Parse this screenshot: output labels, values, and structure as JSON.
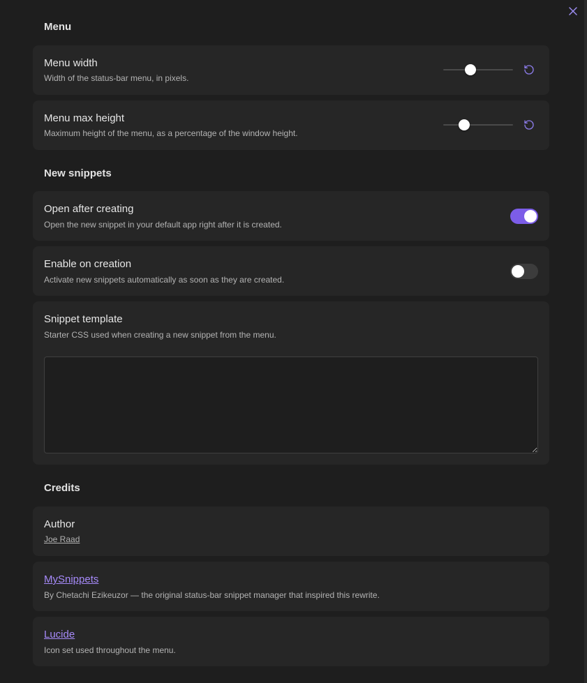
{
  "colors": {
    "accent": "#7c5de8",
    "link": "#a68af9",
    "card": "#262626",
    "background": "#1e1e1e"
  },
  "sections": {
    "menu": "Menu",
    "new_snippets": "New snippets",
    "credits": "Credits"
  },
  "settings": {
    "menu_width": {
      "name": "Menu width",
      "desc": "Width of the status-bar menu, in pixels.",
      "slider_fraction": 0.39
    },
    "menu_max_height": {
      "name": "Menu max height",
      "desc": "Maximum height of the menu, as a percentage of the window height.",
      "slider_fraction": 0.3
    },
    "open_after_creating": {
      "name": "Open after creating",
      "desc": "Open the new snippet in your default app right after it is created.",
      "enabled": true
    },
    "enable_on_creation": {
      "name": "Enable on creation",
      "desc": "Activate new snippets automatically as soon as they are created.",
      "enabled": false
    },
    "snippet_template": {
      "name": "Snippet template",
      "desc": "Starter CSS used when creating a new snippet from the menu.",
      "value": ""
    }
  },
  "credits": {
    "author": {
      "name": "Author",
      "link": "Joe Raad"
    },
    "mysnippets": {
      "link": "MySnippets",
      "desc": "By Chetachi Ezikeuzor — the original status-bar snippet manager that inspired this rewrite."
    },
    "lucide": {
      "link": "Lucide",
      "desc": "Icon set used throughout the menu."
    }
  },
  "icons": {
    "close": "x-icon",
    "reset": "rotate-ccw-icon"
  }
}
